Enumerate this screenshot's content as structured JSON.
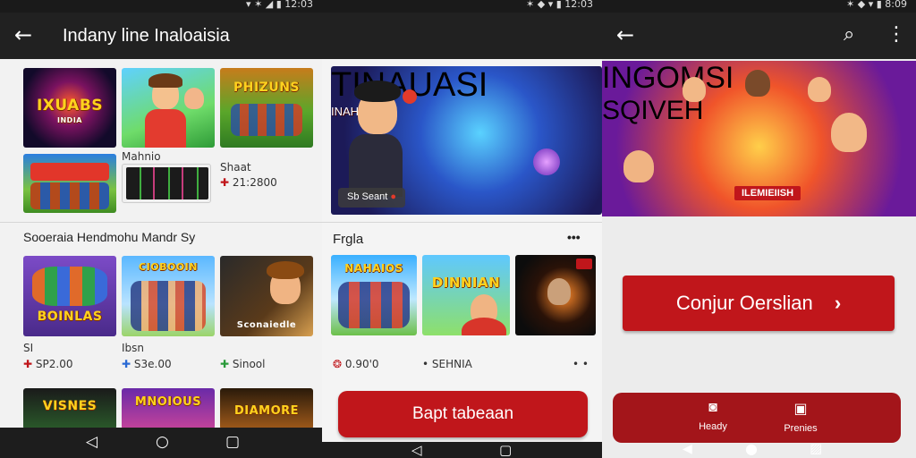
{
  "panel1": {
    "status_time": "12:03",
    "title": "Indany line Inaloaisia",
    "grid1": [
      {
        "caption": "IXUABS",
        "sub": "INDIA"
      },
      {
        "caption": "",
        "sub": ""
      },
      {
        "caption": "PHIZUNS",
        "sub": ""
      },
      {
        "caption": "",
        "sub": ""
      },
      {
        "caption": "",
        "sub": ""
      }
    ],
    "small_label_1": "Mahnio",
    "small_label_2": "Shaat",
    "small_price_1": "21:2800",
    "section_title": "Sooeraia Hendmohu Mandr Sy",
    "grid2": [
      {
        "caption": "BOINLAS"
      },
      {
        "caption": "CIOBOOIN"
      },
      {
        "caption": "Sconaiedle"
      }
    ],
    "row_labels": [
      "SI",
      "Ibsn",
      ""
    ],
    "prices": [
      "SP2.00",
      "S3e.00",
      "Sinool"
    ],
    "grid3": [
      {
        "caption": "VISNES"
      },
      {
        "caption": "MNOIOUS"
      },
      {
        "caption": "DIAMORE"
      }
    ]
  },
  "panel2": {
    "status_time": "12:03",
    "hero_title": "TINAUASI",
    "hero_sub": "INAHEAU",
    "hero_chip": "Sb Seant",
    "section_title": "Frgla",
    "more": "•••",
    "tiles": [
      {
        "caption": "NAHAIOS"
      },
      {
        "caption": "DINNIAN"
      },
      {
        "caption": ""
      }
    ],
    "footer_left": "0.90'0",
    "footer_mid": "• SEHNIA",
    "footer_right": "• •",
    "button_label": "Bapt tabeaan"
  },
  "panel3": {
    "status_time": "8:09",
    "hero_title": "INGOMSI",
    "hero_sub": "SQIVEH",
    "hero_badge": "ILEMIEIISH",
    "button_label": "Conjur Oerslian",
    "bottom_items": [
      {
        "label": "Heady",
        "icon": "camera-icon"
      },
      {
        "label": "Prenies",
        "icon": "photo-icon"
      }
    ]
  },
  "colors": {
    "accent_red": "#c0161b",
    "appbar": "#212121"
  }
}
